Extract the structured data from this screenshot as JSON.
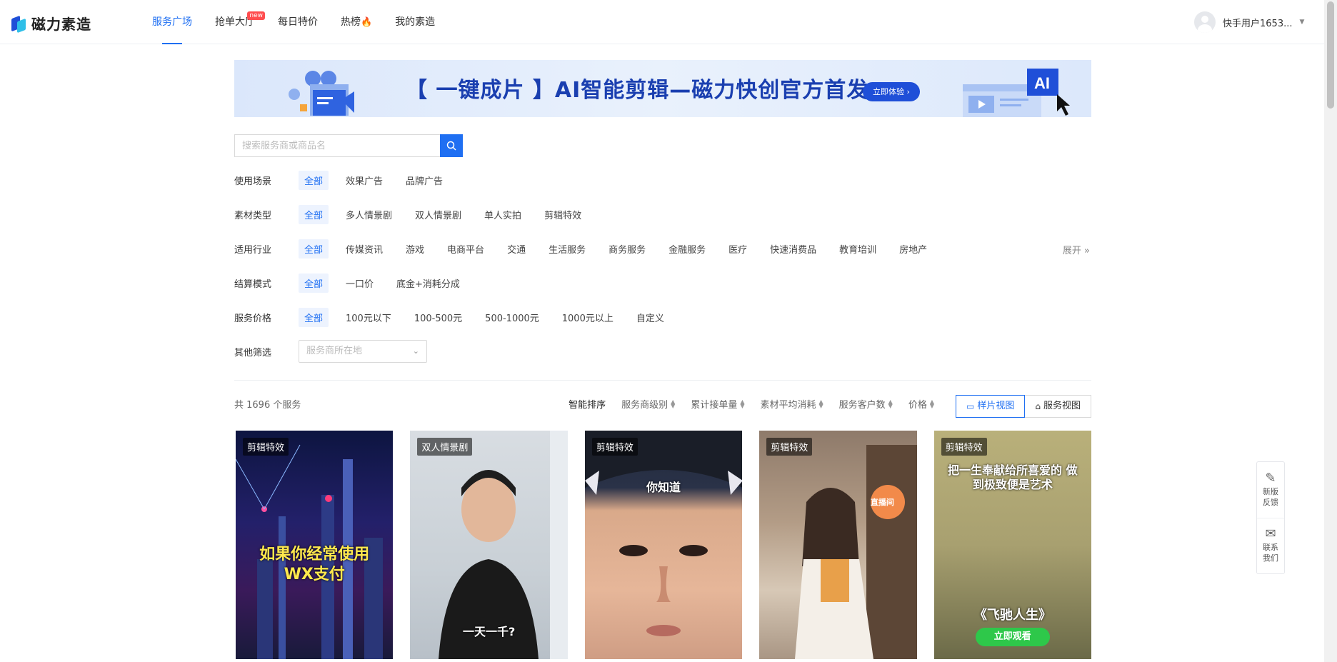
{
  "app": {
    "brand": "磁力素造"
  },
  "nav": {
    "items": [
      {
        "label": "服务广场"
      },
      {
        "label": "抢单大厅",
        "badge": "new"
      },
      {
        "label": "每日特价"
      },
      {
        "label": "热榜"
      },
      {
        "label": "我的素造"
      }
    ],
    "user": "快手用户1653..."
  },
  "banner": {
    "headline": "【 一键成片 】AI智能剪辑—磁力快创官方首发",
    "cta": "立即体验 ›",
    "ai_badge": "AI"
  },
  "search": {
    "placeholder": "搜索服务商或商品名"
  },
  "filters": {
    "scene": {
      "label": "使用场景",
      "options": [
        "全部",
        "效果广告",
        "品牌广告"
      ]
    },
    "material": {
      "label": "素材类型",
      "options": [
        "全部",
        "多人情景剧",
        "双人情景剧",
        "单人实拍",
        "剪辑特效"
      ]
    },
    "industry": {
      "label": "适用行业",
      "options": [
        "全部",
        "传媒资讯",
        "游戏",
        "电商平台",
        "交通",
        "生活服务",
        "商务服务",
        "金融服务",
        "医疗",
        "快速消费品",
        "教育培训",
        "房地产"
      ],
      "expand": "展开 »"
    },
    "settle": {
      "label": "结算模式",
      "options": [
        "全部",
        "一口价",
        "底金+消耗分成"
      ]
    },
    "price": {
      "label": "服务价格",
      "options": [
        "全部",
        "100元以下",
        "100-500元",
        "500-1000元",
        "1000元以上",
        "自定义"
      ]
    },
    "other": {
      "label": "其他筛选",
      "select_placeholder": "服务商所在地"
    }
  },
  "results": {
    "total_text": "共 1696 个服务",
    "sorts": [
      "智能排序",
      "服务商级别",
      "累计接单量",
      "素材平均消耗",
      "服务客户数",
      "价格"
    ],
    "views": [
      "样片视图",
      "服务视图"
    ]
  },
  "cards": [
    {
      "tag": "剪辑特效",
      "caption": "如果你经常使用 WX支付"
    },
    {
      "tag": "双人情景剧",
      "caption": "一天一千?"
    },
    {
      "tag": "剪辑特效",
      "caption": "你知道"
    },
    {
      "tag": "剪辑特效",
      "caption": "直播间"
    },
    {
      "tag": "剪辑特效",
      "caption": "把一生奉献给所喜爱的 做到极致便是艺术",
      "sub": "《飞驰人生》",
      "btn": "立即观看"
    }
  ],
  "side_widget": {
    "feedback": "新版反馈",
    "contact": "联系我们"
  },
  "colors": {
    "primary": "#1f6ff2",
    "brand_dark": "#1a3fb0",
    "badge": "#ff4d4f"
  }
}
